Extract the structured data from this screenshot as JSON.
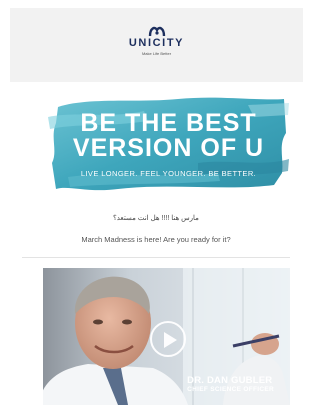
{
  "header": {
    "logo_word": "UNICITY",
    "logo_tagline": "Make Life Better"
  },
  "hero": {
    "line1": "BE THE BEST",
    "line2": "VERSION OF U",
    "subline": "LIVE LONGER. FEEL YOUNGER. BE BETTER.",
    "brush_color": "#4fb0c4"
  },
  "intro": {
    "arabic": "مارس هنا !!!! هل انت مستعد؟",
    "english": "March Madness is here! Are you ready for it?"
  },
  "video": {
    "name": "DR. DAN GUBLER",
    "role": "CHIEF SCIENCE OFFICER",
    "play_icon": "play-icon"
  },
  "colors": {
    "brand_navy": "#1d2f5e",
    "teal": "#3fa7bd"
  }
}
